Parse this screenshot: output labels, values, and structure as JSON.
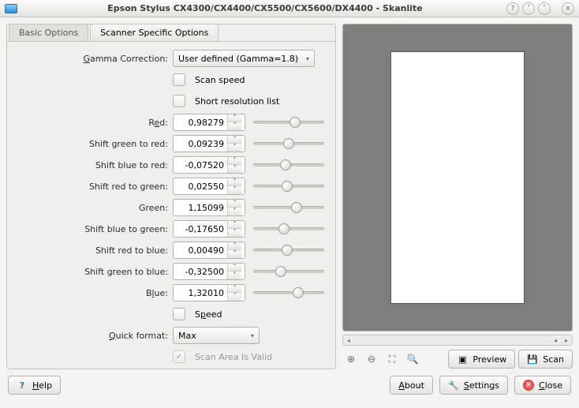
{
  "window": {
    "title": "Epson Stylus CX4300/CX4400/CX5500/CX5600/DX4400 - Skanlite"
  },
  "tabs": {
    "basic": "Basic Options",
    "scanner": "Scanner Specific Options"
  },
  "form": {
    "gamma_label": "Gamma Correction:",
    "gamma_value": "User defined (Gamma=1.8)",
    "scan_speed": "Scan speed",
    "short_res": "Short resolution list",
    "red_label": "Red:",
    "red_value": "0,98279",
    "sgr_label": "Shift green to red:",
    "sgr_value": "0,09239",
    "sbr_label": "Shift blue to red:",
    "sbr_value": "-0,07520",
    "srg_label": "Shift red to green:",
    "srg_value": "0,02550",
    "green_label": "Green:",
    "green_value": "1,15099",
    "sbg_label": "Shift blue to green:",
    "sbg_value": "-0,17650",
    "srb_label": "Shift red to blue:",
    "srb_value": "0,00490",
    "sgb_label": "Shift green to blue:",
    "sgb_value": "-0,32500",
    "blue_label": "Blue:",
    "blue_value": "1,32010",
    "speed": "Speed",
    "quick_format_label": "Quick format:",
    "quick_format_value": "Max",
    "scan_area_valid": "Scan Area Is Valid"
  },
  "buttons": {
    "preview": "Preview",
    "scan": "Scan",
    "help": "Help",
    "about": "About",
    "settings": "Settings",
    "close": "Close"
  }
}
